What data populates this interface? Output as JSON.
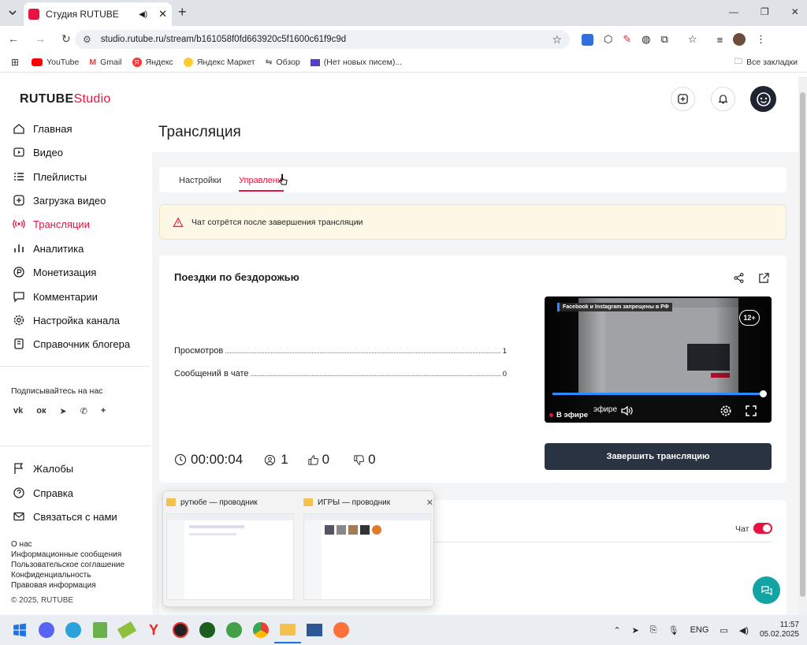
{
  "browser": {
    "tab_title": "Студия RUTUBE",
    "url": "studio.rutube.ru/stream/b161058f0fd663920c5f1600c61f9c9d",
    "bookmarks": [
      "YouTube",
      "Gmail",
      "Яндекс",
      "Яндекс Маркет",
      "Обзор",
      "(Нет новых писем)..."
    ],
    "all_bookmarks": "Все закладки"
  },
  "app": {
    "logo_main": "RUTUBE",
    "logo_studio": "Studio",
    "nav": [
      "Главная",
      "Видео",
      "Плейлисты",
      "Загрузка видео",
      "Трансляции",
      "Аналитика",
      "Монетизация",
      "Комментарии",
      "Настройка канала",
      "Справочник блогера"
    ],
    "active_nav": "Трансляции",
    "subscribe_label": "Подписывайтесь на нас",
    "social_plus": "+",
    "bottom_nav": [
      "Жалобы",
      "Справка",
      "Связаться с нами"
    ],
    "footer_links": [
      "О нас",
      "Информационные сообщения",
      "Пользовательское соглашение",
      "Конфиденциальность",
      "Правовая информация"
    ],
    "copyright": "© 2025, RUTUBE"
  },
  "page": {
    "title": "Трансляция",
    "tabs": [
      "Настройки",
      "Управление"
    ],
    "warning": "Чат сотрётся после завершения трансляции",
    "stream_title": "Поездки по бездорожью",
    "stats": [
      {
        "label": "Просмотров",
        "value": "1"
      },
      {
        "label": "Сообщений в чате",
        "value": "0"
      }
    ],
    "timer": "00:00:04",
    "viewers": "1",
    "likes": "0",
    "dislikes": "0",
    "end_button": "Завершить трансляцию",
    "chat_label": "Чат",
    "chat_enabled": true,
    "player": {
      "age_badge": "12+",
      "live_label": "В эфире",
      "banner": "Facebook и Instagram запрещены в РФ",
      "progress": 1.0
    }
  },
  "taskbar_previews": [
    {
      "title": "рутюбе — проводник"
    },
    {
      "title": "ИГРЫ — проводник"
    }
  ],
  "tray": {
    "lang": "ENG",
    "time": "11:57",
    "date": "05.02.2025"
  },
  "colors": {
    "accent": "#e8133f",
    "dark_button": "#2a3342",
    "warning_bg": "#fdf8e5"
  }
}
